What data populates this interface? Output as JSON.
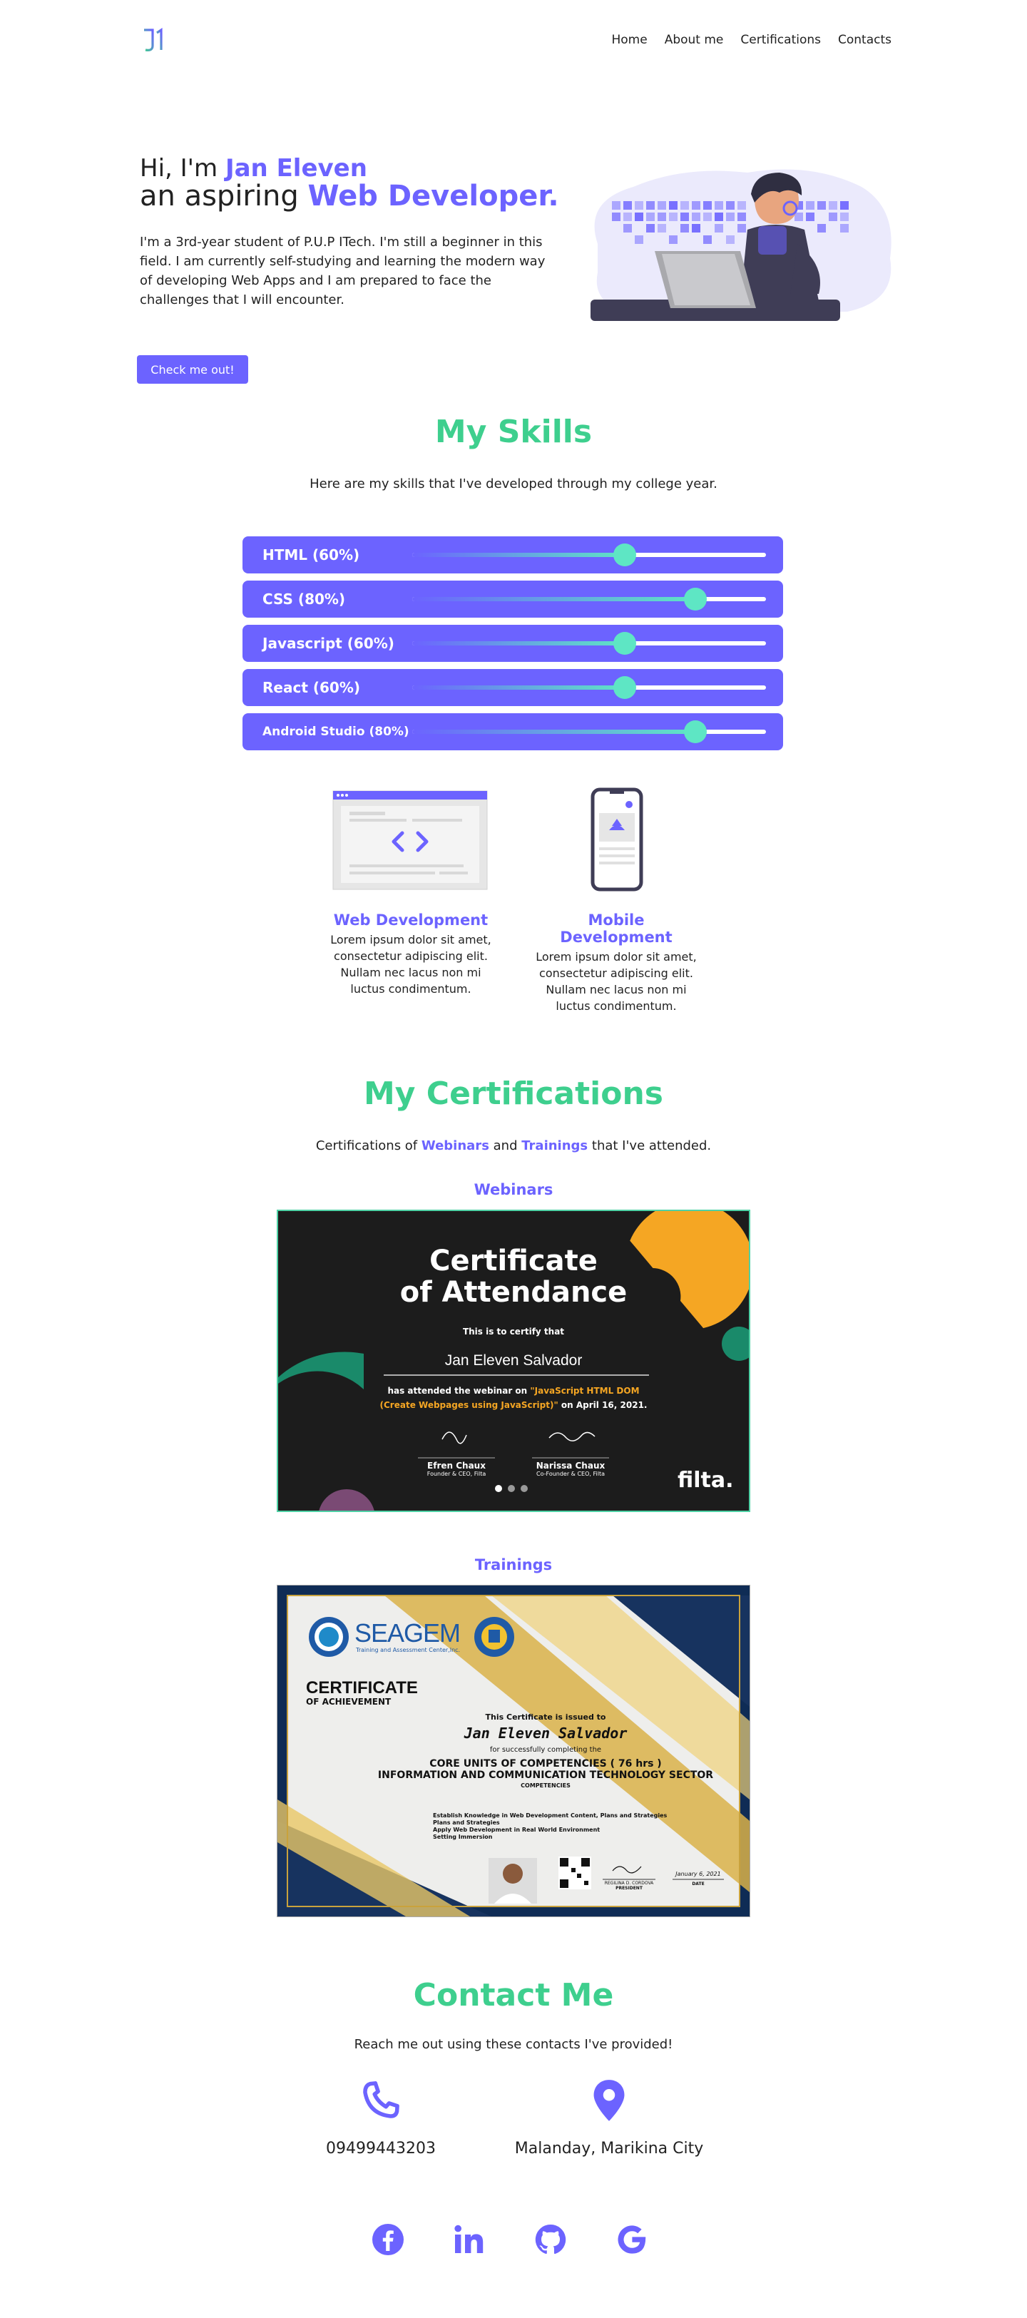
{
  "nav": {
    "logo_text": "J1",
    "links": [
      "Home",
      "About me",
      "Certifications",
      "Contacts"
    ]
  },
  "hero": {
    "greeting_prefix": "Hi, I'm",
    "name": "Jan Eleven",
    "role_prefix": "an aspiring",
    "role": "Web Developer.",
    "description": "I'm a 3rd-year student of P.U.P ITech. I'm still a beginner in this field. I am currently self-studying and learning the modern way of developing Web Apps and I am prepared to face the challenges that I will encounter.",
    "cta_label": "Check me out!"
  },
  "skills": {
    "title": "My Skills",
    "subtitle": "Here are my skills that I've developed through my college year.",
    "items": [
      {
        "label": "HTML  (60%)",
        "level": 0.6
      },
      {
        "label": "CSS  (80%)",
        "level": 0.8
      },
      {
        "label": "Javascript  (60%)",
        "level": 0.6
      },
      {
        "label": "React  (60%)",
        "level": 0.6
      },
      {
        "label": "Android Studio  (80%)",
        "level": 0.8
      }
    ]
  },
  "services": [
    {
      "title": "Web Development",
      "desc": "Lorem ipsum dolor sit amet, consectetur adipiscing elit. Nullam nec lacus non mi luctus condimentum."
    },
    {
      "title": "Mobile Development",
      "desc": "Lorem ipsum dolor sit amet, consectetur adipiscing elit. Nullam nec lacus non mi luctus condimentum."
    }
  ],
  "certifications": {
    "title": "My Certifications",
    "subtitle_prefix": "Certifications of",
    "subtitle_webinars": "Webinars",
    "subtitle_and": "and",
    "subtitle_trainings": "Trainings",
    "subtitle_suffix": "that I've attended.",
    "webinars_heading": "Webinars",
    "trainings_heading": "Trainings",
    "webinar_cert": {
      "title_line1": "Certificate",
      "title_line2": "of Attendance",
      "certify": "This is to certify that",
      "recipient": "Jan Eleven Salvador",
      "attended_prefix": "has attended the webinar on",
      "topic_line1": "\"JavaScript HTML DOM",
      "topic_line2": "(Create Webpages using JavaScript)\"",
      "date": "on April 16, 2021.",
      "signer1_name": "Efren Chaux",
      "signer1_role": "Founder & CEO, Filta",
      "signer2_name": "Narissa Chaux",
      "signer2_role": "Co-Founder & CEO, Filta",
      "brand": "filta."
    },
    "training_cert": {
      "org": "SEAGEM",
      "org_sub": "Training and Assessment Center,Inc.",
      "title": "CERTIFICATE",
      "title_sub": "OF ACHIEVEMENT",
      "issued": "This Certificate is issued to",
      "recipient": "Jan Eleven Salvador",
      "completing": "for successfully completing the",
      "course_line1": "CORE UNITS OF COMPETENCIES ( 76 hrs )",
      "course_line2": "INFORMATION AND COMMUNICATION TECHNOLOGY SECTOR",
      "competencies_label": "COMPETENCIES",
      "competencies": [
        "Establish Knowledge in Web Development Content, Plans and Strategies",
        "Plans and Strategies",
        "Apply Web Development in Real World Environment",
        "Setting Immersion"
      ],
      "signer": "REGILINA D. CORDOVA",
      "signer_role": "PRESIDENT",
      "date": "January 6, 2021",
      "date_label": "DATE"
    }
  },
  "contact": {
    "title": "Contact Me",
    "subtitle": "Reach me out using these contacts I've provided!",
    "phone": "09499443203",
    "location": "Malanday, Marikina City"
  },
  "colors": {
    "accent": "#6c63ff",
    "green": "#3ecf8e",
    "mint": "#5ee6c4"
  }
}
